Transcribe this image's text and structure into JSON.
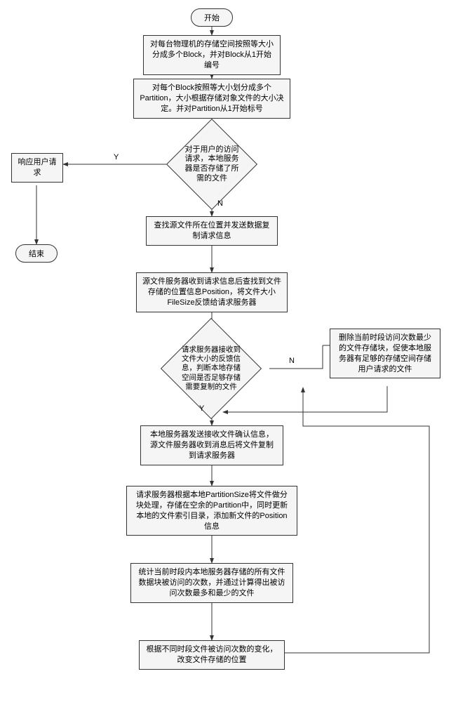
{
  "terminals": {
    "start": "开始",
    "end": "结束"
  },
  "steps": {
    "s1": "对每台物理机的存储空间按照等大小分成多个Block，并对Block从1开始编号",
    "s2": "对每个Block按照等大小划分成多个Partition，大小根据存储对象文件的大小决定。并对Partition从1开始标号",
    "d1": "对于用户的访问请求，本地服务器是否存储了所需的文件",
    "respond": "响应用户请求",
    "s3": "查找源文件所在位置并发送数据复制请求信息",
    "s4": "源文件服务器收到请求信息后查找到文件存储的位置信息Position，将文件大小FileSize反馈给请求服务器",
    "d2": "请求服务器接收到文件大小的反馈信息，判断本地存储空间是否足够存储需要复制的文件",
    "del": "删除当前时段访问次数最少的文件存储块，促使本地服务器有足够的存储空间存储用户请求的文件",
    "s5": "本地服务器发送接收文件确认信息，源文件服务器收到消息后将文件复制到请求服务器",
    "s6": "请求服务器根据本地PartitionSize将文件做分块处理，存储在空余的Partition中，同时更新本地的文件索引目录，添加新文件的Position信息",
    "s7": "统计当前时段内本地服务器存储的所有文件数据块被访问的次数，并通过计算得出被访问次数最多和最少的文件",
    "s8": "根据不同时段文件被访问次数的变化，改变文件存储的位置"
  },
  "labels": {
    "yes": "Y",
    "no": "N"
  },
  "chart_data": {
    "type": "flowchart",
    "nodes": [
      {
        "id": "start",
        "type": "terminator",
        "text": "开始"
      },
      {
        "id": "s1",
        "type": "process",
        "text": "对每台物理机的存储空间按照等大小分成多个Block，并对Block从1开始编号"
      },
      {
        "id": "s2",
        "type": "process",
        "text": "对每个Block按照等大小划分成多个Partition，大小根据存储对象文件的大小决定。并对Partition从1开始标号"
      },
      {
        "id": "d1",
        "type": "decision",
        "text": "对于用户的访问请求，本地服务器是否存储了所需的文件"
      },
      {
        "id": "respond",
        "type": "process",
        "text": "响应用户请求"
      },
      {
        "id": "end",
        "type": "terminator",
        "text": "结束"
      },
      {
        "id": "s3",
        "type": "process",
        "text": "查找源文件所在位置并发送数据复制请求信息"
      },
      {
        "id": "s4",
        "type": "process",
        "text": "源文件服务器收到请求信息后查找到文件存储的位置信息Position，将文件大小FileSize反馈给请求服务器"
      },
      {
        "id": "d2",
        "type": "decision",
        "text": "请求服务器接收到文件大小的反馈信息，判断本地存储空间是否足够存储需要复制的文件"
      },
      {
        "id": "del",
        "type": "process",
        "text": "删除当前时段访问次数最少的文件存储块，促使本地服务器有足够的存储空间存储用户请求的文件"
      },
      {
        "id": "s5",
        "type": "process",
        "text": "本地服务器发送接收文件确认信息，源文件服务器收到消息后将文件复制到请求服务器"
      },
      {
        "id": "s6",
        "type": "process",
        "text": "请求服务器根据本地PartitionSize将文件做分块处理，存储在空余的Partition中，同时更新本地的文件索引目录，添加新文件的Position信息"
      },
      {
        "id": "s7",
        "type": "process",
        "text": "统计当前时段内本地服务器存储的所有文件数据块被访问的次数，并通过计算得出被访问次数最多和最少的文件"
      },
      {
        "id": "s8",
        "type": "process",
        "text": "根据不同时段文件被访问次数的变化，改变文件存储的位置"
      }
    ],
    "edges": [
      {
        "from": "start",
        "to": "s1"
      },
      {
        "from": "s1",
        "to": "s2"
      },
      {
        "from": "s2",
        "to": "d1"
      },
      {
        "from": "d1",
        "to": "respond",
        "label": "Y"
      },
      {
        "from": "d1",
        "to": "s3",
        "label": "N"
      },
      {
        "from": "respond",
        "to": "end"
      },
      {
        "from": "s3",
        "to": "s4"
      },
      {
        "from": "s4",
        "to": "d2"
      },
      {
        "from": "d2",
        "to": "del",
        "label": "N"
      },
      {
        "from": "d2",
        "to": "s5",
        "label": "Y"
      },
      {
        "from": "del",
        "to": "s5"
      },
      {
        "from": "s5",
        "to": "s6"
      },
      {
        "from": "s6",
        "to": "s7"
      },
      {
        "from": "s7",
        "to": "s8"
      },
      {
        "from": "s8",
        "to": "d2"
      }
    ]
  }
}
